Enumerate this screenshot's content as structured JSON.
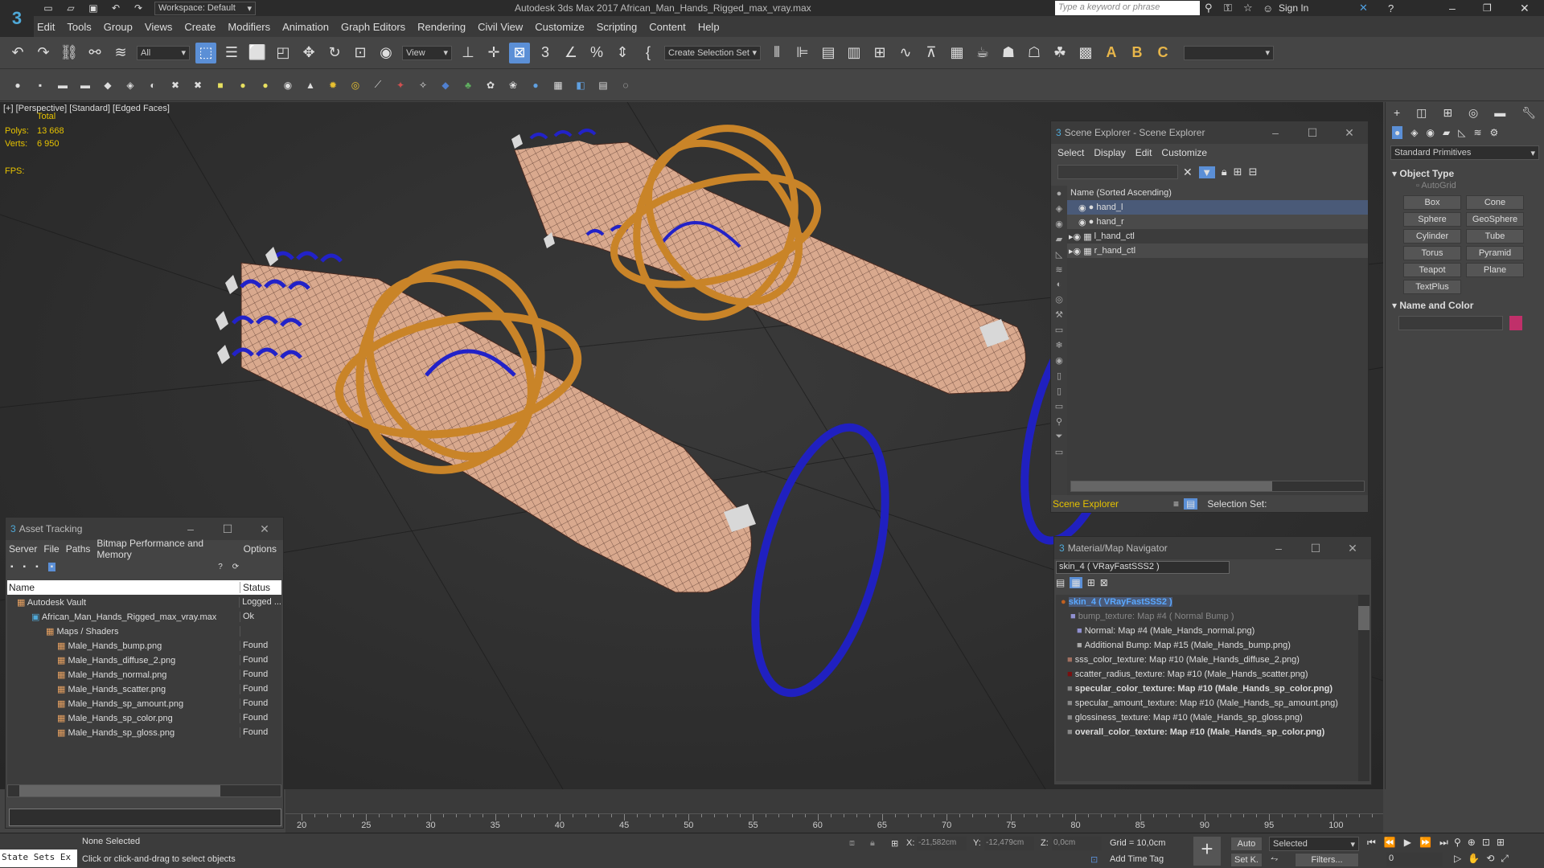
{
  "titlebar": {
    "workspace": "Workspace: Default",
    "title": "Autodesk 3ds Max 2017    African_Man_Hands_Rigged_max_vray.max",
    "search_placeholder": "Type a keyword or phrase",
    "sign_in": "Sign In"
  },
  "menu": [
    "Edit",
    "Tools",
    "Group",
    "Views",
    "Create",
    "Modifiers",
    "Animation",
    "Graph Editors",
    "Rendering",
    "Civil View",
    "Customize",
    "Scripting",
    "Content",
    "Help"
  ],
  "toolbar": {
    "filter": "All",
    "view": "View",
    "selection_set": "Create Selection Set"
  },
  "viewport": {
    "label": "[+] [Perspective] [Standard] [Edged Faces]",
    "total": "Total",
    "polys_label": "Polys:",
    "polys": "13 668",
    "verts_label": "Verts:",
    "verts": "6 950",
    "fps_label": "FPS:"
  },
  "scene_explorer": {
    "title": "Scene Explorer - Scene Explorer",
    "menu": [
      "Select",
      "Display",
      "Edit",
      "Customize"
    ],
    "column": "Name (Sorted Ascending)",
    "rows": [
      "hand_l",
      "hand_r",
      "l_hand_ctl",
      "r_hand_ctl"
    ],
    "footer_name": "Scene Explorer",
    "footer_selset": "Selection Set:"
  },
  "asset_tracking": {
    "title": "Asset Tracking",
    "menu": [
      "Server",
      "File",
      "Paths",
      "Bitmap Performance and Memory",
      "Options"
    ],
    "col_name": "Name",
    "col_status": "Status",
    "rows": [
      {
        "name": "Autodesk Vault",
        "status": "Logged ..."
      },
      {
        "name": "African_Man_Hands_Rigged_max_vray.max",
        "status": "Ok"
      },
      {
        "name": "Maps / Shaders",
        "status": ""
      },
      {
        "name": "Male_Hands_bump.png",
        "status": "Found"
      },
      {
        "name": "Male_Hands_diffuse_2.png",
        "status": "Found"
      },
      {
        "name": "Male_Hands_normal.png",
        "status": "Found"
      },
      {
        "name": "Male_Hands_scatter.png",
        "status": "Found"
      },
      {
        "name": "Male_Hands_sp_amount.png",
        "status": "Found"
      },
      {
        "name": "Male_Hands_sp_color.png",
        "status": "Found"
      },
      {
        "name": "Male_Hands_sp_gloss.png",
        "status": "Found"
      }
    ]
  },
  "material_navigator": {
    "title": "Material/Map Navigator",
    "field": "skin_4  ( VRayFastSSS2 )",
    "rows": [
      {
        "text": "skin_4  ( VRayFastSSS2 )",
        "bold": true
      },
      {
        "text": "bump_texture: Map #4  ( Normal Bump )",
        "bold": false,
        "dim": true
      },
      {
        "text": "Normal: Map #4 (Male_Hands_normal.png)",
        "bold": false
      },
      {
        "text": "Additional Bump: Map #15 (Male_Hands_bump.png)",
        "bold": false
      },
      {
        "text": "sss_color_texture: Map #10 (Male_Hands_diffuse_2.png)",
        "bold": false
      },
      {
        "text": "scatter_radius_texture: Map #10 (Male_Hands_scatter.png)",
        "bold": false
      },
      {
        "text": "specular_color_texture: Map #10 (Male_Hands_sp_color.png)",
        "bold": true
      },
      {
        "text": "specular_amount_texture: Map #10 (Male_Hands_sp_amount.png)",
        "bold": false
      },
      {
        "text": "glossiness_texture: Map #10 (Male_Hands_sp_gloss.png)",
        "bold": false
      },
      {
        "text": "overall_color_texture: Map #10 (Male_Hands_sp_color.png)",
        "bold": true
      }
    ]
  },
  "command_panel": {
    "category": "Standard Primitives",
    "object_type": "Object Type",
    "autogrid": "AutoGrid",
    "buttons": [
      "Box",
      "Cone",
      "Sphere",
      "GeoSphere",
      "Cylinder",
      "Tube",
      "Torus",
      "Pyramid",
      "Teapot",
      "Plane",
      "TextPlus"
    ],
    "name_color": "Name and Color",
    "color": "#c0306a"
  },
  "timeline": {
    "ticks": [
      "20",
      "25",
      "30",
      "35",
      "40",
      "45",
      "50",
      "55",
      "60",
      "65",
      "70",
      "75",
      "80",
      "85",
      "90",
      "95",
      "100"
    ]
  },
  "status": {
    "none_selected": "None Selected",
    "hint": "Click or click-and-drag to select objects",
    "state_sets": "State Sets Ex",
    "x_label": "X:",
    "x": "-21,582cm",
    "y_label": "Y:",
    "y": "-12,479cm",
    "z_label": "Z:",
    "z": "0,0cm",
    "grid": "Grid = 10,0cm",
    "add_time_tag": "Add Time Tag",
    "auto": "Auto",
    "selected": "Selected",
    "set_k": "Set K.",
    "filters": "Filters...",
    "frame": "0"
  }
}
